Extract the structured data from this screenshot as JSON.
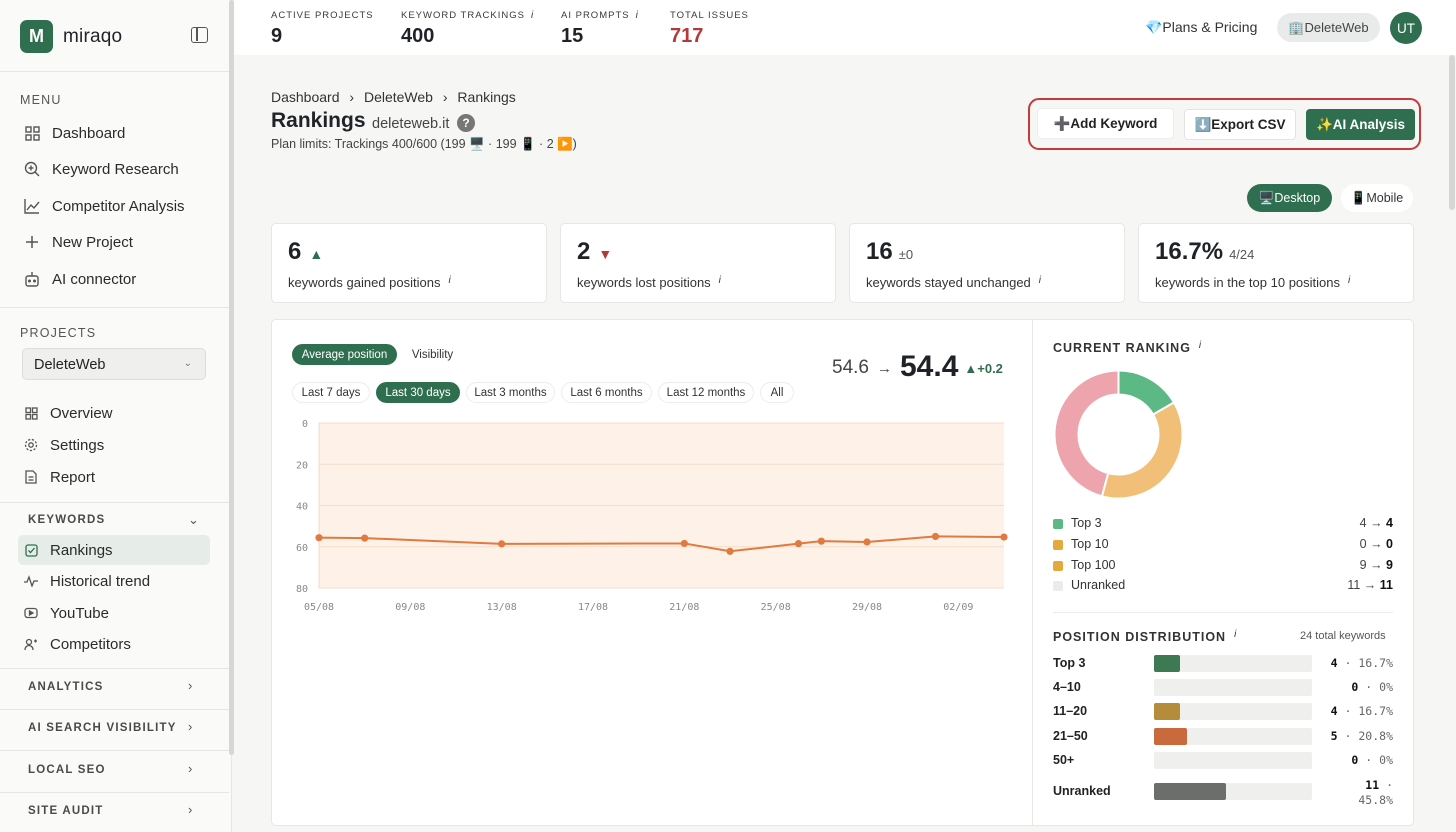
{
  "sidebar": {
    "logo_letter": "M",
    "brand": "miraqo",
    "menu_label": "MENU",
    "menu": [
      {
        "label": "Dashboard",
        "icon": "grid-icon"
      },
      {
        "label": "Keyword Research",
        "icon": "search-plus-icon"
      },
      {
        "label": "Competitor Analysis",
        "icon": "line-chart-icon"
      },
      {
        "label": "New Project",
        "icon": "plus-icon"
      },
      {
        "label": "AI connector",
        "icon": "robot-icon"
      }
    ],
    "projects_label": "PROJECTS",
    "project_selected": "DeleteWeb",
    "project_items": [
      {
        "label": "Overview",
        "icon": "grid-icon"
      },
      {
        "label": "Settings",
        "icon": "gear-icon"
      },
      {
        "label": "Report",
        "icon": "document-icon"
      }
    ],
    "keywords_section": "KEYWORDS",
    "keyword_items": [
      {
        "label": "Rankings",
        "icon": "checkbox-icon"
      },
      {
        "label": "Historical trend",
        "icon": "pulse-icon"
      },
      {
        "label": "YouTube",
        "icon": "youtube-icon"
      },
      {
        "label": "Competitors",
        "icon": "users-icon"
      }
    ],
    "collapsed_sections": [
      "ANALYTICS",
      "AI SEARCH VISIBILITY",
      "LOCAL SEO",
      "SITE AUDIT"
    ]
  },
  "topbar": {
    "stats": [
      {
        "label": "ACTIVE PROJECTS",
        "value": "9",
        "info": ""
      },
      {
        "label": "KEYWORD TRACKINGS",
        "value": "400",
        "info": "i"
      },
      {
        "label": "AI PROMPTS",
        "value": "15",
        "info": "i"
      },
      {
        "label": "TOTAL ISSUES",
        "value": "717",
        "info": ""
      }
    ],
    "plans": "💎Plans & Pricing",
    "user_chip": "🏢DeleteWeb",
    "avatar": "UT"
  },
  "page": {
    "breadcrumb": [
      "Dashboard",
      "DeleteWeb",
      "Rankings"
    ],
    "breadcrumb_sep": "›",
    "title": "Rankings",
    "domain": "deleteweb.it",
    "help": "?",
    "limits": "Plan limits: Trackings 400/600 (199 🖥️ · 199 📱 · 2 ▶️)",
    "buttons": {
      "add": "➕Add Keyword",
      "csv": "⬇️Export CSV",
      "ai": "✨AI Analysis"
    },
    "device": {
      "desktop": "🖥️Desktop",
      "mobile": "📱Mobile"
    }
  },
  "cards": [
    {
      "big": "6",
      "trend": "▲",
      "trend_kind": "up",
      "extra": "",
      "label": "keywords gained positions",
      "info": "i"
    },
    {
      "big": "2",
      "trend": "▼",
      "trend_kind": "down",
      "extra": "",
      "label": "keywords lost positions",
      "info": "i"
    },
    {
      "big": "16",
      "trend": "",
      "trend_kind": "",
      "extra": "±0",
      "label": "keywords stayed unchanged",
      "info": "i"
    },
    {
      "big": "16.7%",
      "trend": "",
      "trend_kind": "",
      "extra": "4/24",
      "label": "keywords in the top 10 positions",
      "info": "i"
    }
  ],
  "chart_controls": {
    "metrics": [
      "Average position",
      "Visibility"
    ],
    "active_metric": 0,
    "ranges": [
      "Last 7 days",
      "Last 30 days",
      "Last 3 months",
      "Last 6 months",
      "Last 12 months",
      "All"
    ],
    "active_range": 1,
    "prev": "54.6",
    "arrow": "→",
    "now": "54.4",
    "delta": "▲+0.2"
  },
  "chart_data": {
    "type": "line",
    "x": [
      "05/08",
      "07/08",
      "13/08",
      "21/08",
      "23/08",
      "26/08",
      "27/08",
      "29/08",
      "01/09",
      "04/09"
    ],
    "x_numeric_day": [
      0,
      2,
      8,
      16,
      18,
      21,
      22,
      24,
      27,
      30
    ],
    "values": [
      55.6,
      55.8,
      58.6,
      58.4,
      62.2,
      58.5,
      57.3,
      57.7,
      55.0,
      55.3
    ],
    "xticks": [
      "05/08",
      "09/08",
      "13/08",
      "17/08",
      "21/08",
      "25/08",
      "29/08",
      "02/09"
    ],
    "yticks": [
      "0",
      "20",
      "40",
      "60",
      "80"
    ],
    "ylim": [
      0,
      80
    ],
    "y_inverted": true,
    "color": "#e07a3f"
  },
  "ranking": {
    "title": "CURRENT RANKING",
    "info": "i",
    "donut": [
      {
        "name": "Top 3",
        "value": 4,
        "color": "#5cb884"
      },
      {
        "name": "Top 10",
        "value": 0,
        "color": "#e3a93c"
      },
      {
        "name": "Top 100",
        "value": 9,
        "color": "#f2bf78"
      },
      {
        "name": "Unranked",
        "value": 11,
        "color": "#eda4ad"
      }
    ],
    "legend": [
      {
        "name": "Top 3",
        "from": "4",
        "to": "4",
        "color": "#5cb884"
      },
      {
        "name": "Top 10",
        "from": "0",
        "to": "0",
        "color": "#e3a93c"
      },
      {
        "name": "Top 100",
        "from": "9",
        "to": "9",
        "color": "#e3a93c"
      },
      {
        "name": "Unranked",
        "from": "11",
        "to": "11",
        "color": "#ebebea"
      }
    ],
    "arrow": "→"
  },
  "distribution": {
    "title": "POSITION DISTRIBUTION",
    "info": "i",
    "total": "24 total keywords",
    "rows": [
      {
        "name": "Top 3",
        "count": "4",
        "pct": "16.7%",
        "frac": 0.167,
        "color": "#3d7a54"
      },
      {
        "name": "4–10",
        "count": "0",
        "pct": "0%",
        "frac": 0,
        "color": "#3d7a54"
      },
      {
        "name": "11–20",
        "count": "4",
        "pct": "16.7%",
        "frac": 0.167,
        "color": "#b58d3a"
      },
      {
        "name": "21–50",
        "count": "5",
        "pct": "20.8%",
        "frac": 0.208,
        "color": "#c96a3c"
      },
      {
        "name": "50+",
        "count": "0",
        "pct": "0%",
        "frac": 0,
        "color": "#c96a3c"
      },
      {
        "name": "Unranked",
        "count": "11",
        "pct": "45.8%",
        "frac": 0.458,
        "color": "#6b6e6b"
      }
    ],
    "sep": "·"
  }
}
